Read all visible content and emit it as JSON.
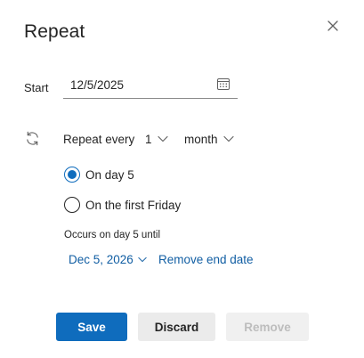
{
  "dialog": {
    "title": "Repeat"
  },
  "start": {
    "label": "Start",
    "date_value": "12/5/2025"
  },
  "repeat": {
    "label": "Repeat every",
    "interval_value": "1",
    "unit_value": "month"
  },
  "options": {
    "on_day_label": "On day 5",
    "on_day_checked": true,
    "first_weekday_label": "On the first Friday",
    "first_weekday_checked": false
  },
  "end": {
    "occurs_text": "Occurs on day 5 until",
    "end_date": "Dec 5, 2026",
    "remove_end_label": "Remove end date"
  },
  "actions": {
    "save_label": "Save",
    "discard_label": "Discard",
    "remove_label": "Remove"
  },
  "colors": {
    "accent": "#0f6cbd",
    "link": "#115ea3",
    "text": "#242424",
    "disabled_bg": "#f0f0f0",
    "disabled_text": "#bdbdbd"
  },
  "icons": {
    "close": "close-icon",
    "calendar": "calendar-icon",
    "repeat": "repeat-icon",
    "chevron": "chevron-down-icon"
  }
}
